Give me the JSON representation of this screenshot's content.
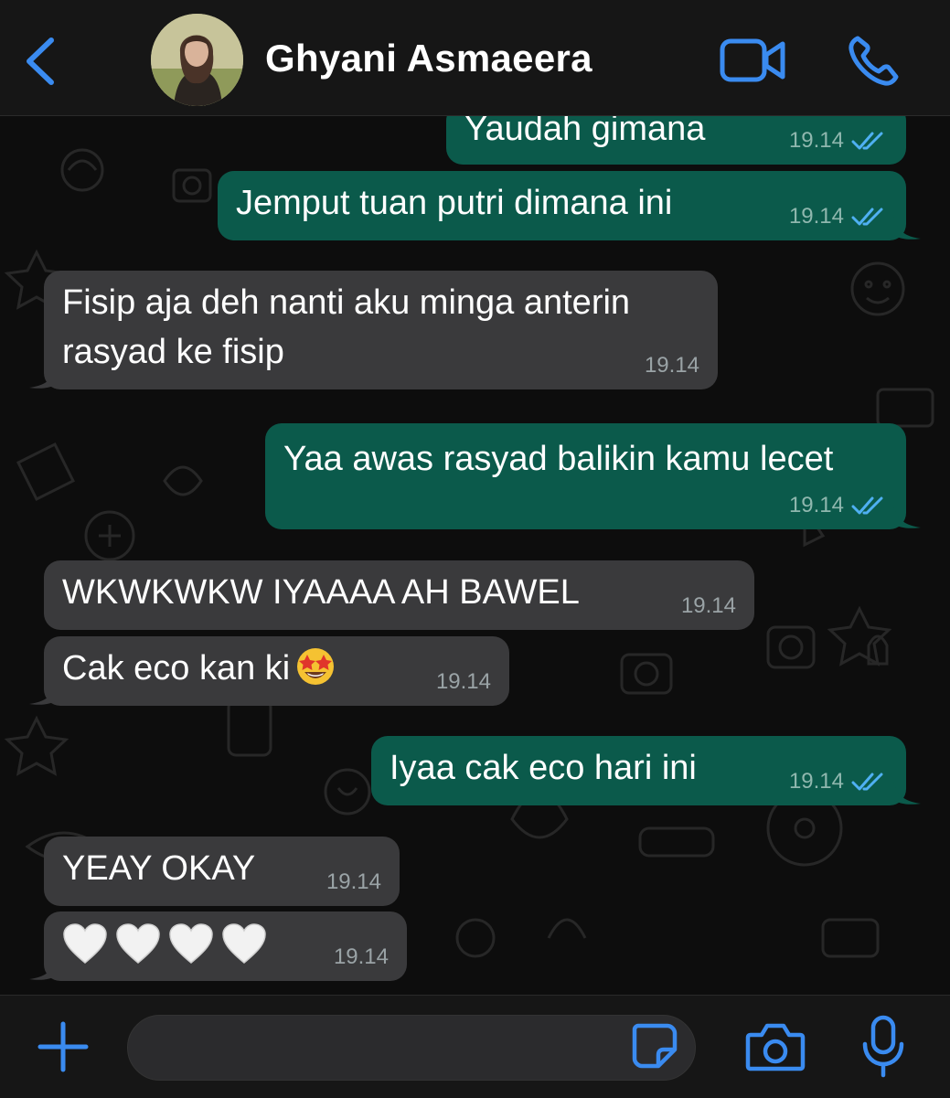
{
  "header": {
    "contact_name": "Ghyani Asmaeera",
    "back_icon": "chevron-left-icon",
    "video_icon": "video-call-icon",
    "call_icon": "phone-icon"
  },
  "colors": {
    "accent": "#3a8bf0",
    "incoming_bubble": "#3a3a3c",
    "outgoing_bubble": "#0b5a4b",
    "read_tick": "#4fb0f2"
  },
  "messages": [
    {
      "direction": "out",
      "text": "Yaudah gimana",
      "time": "19.14",
      "status": "read"
    },
    {
      "direction": "out",
      "text": "Jemput tuan putri dimana ini",
      "time": "19.14",
      "status": "read"
    },
    {
      "direction": "in",
      "text_line1": "Fisip aja deh nanti aku minga anterin",
      "text_line2": "rasyad ke fisip",
      "time": "19.14"
    },
    {
      "direction": "out",
      "text": "Yaa awas rasyad balikin kamu lecet",
      "time": "19.14",
      "status": "read"
    },
    {
      "direction": "in",
      "text": "WKWKWKW IYAAAA AH BAWEL",
      "time": "19.14"
    },
    {
      "direction": "in",
      "text": "Cak eco kan ki",
      "emoji": "star-struck-emoji",
      "time": "19.14"
    },
    {
      "direction": "out",
      "text": "Iyaa cak eco hari ini",
      "time": "19.14",
      "status": "read"
    },
    {
      "direction": "in",
      "text": "YEAY OKAY",
      "time": "19.14"
    },
    {
      "direction": "in",
      "emoji": "white-heart-emoji x4",
      "time": "19.14"
    }
  ],
  "input_bar": {
    "plus_icon": "plus-icon",
    "sticker_icon": "sticker-icon",
    "camera_icon": "camera-icon",
    "mic_icon": "microphone-icon",
    "placeholder": ""
  }
}
